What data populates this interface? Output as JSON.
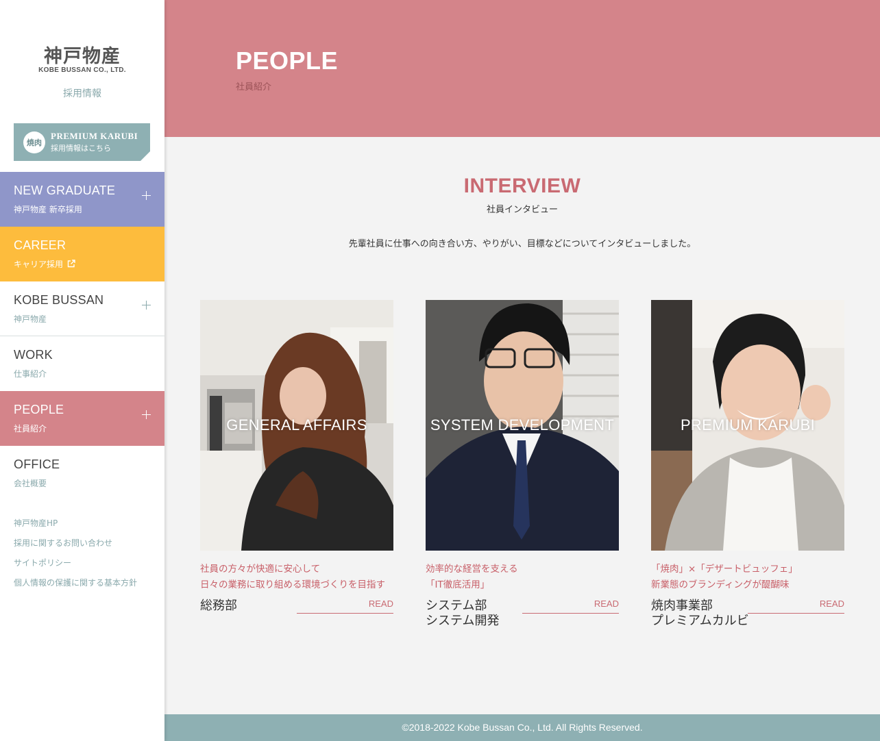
{
  "sidebar": {
    "logo_jp": "神戸物産",
    "logo_en": "KOBE BUSSAN CO., LTD.",
    "recruit_label": "採用情報",
    "banner": {
      "emblem": "焼肉",
      "title": "PREMIUM KARUBI",
      "subtitle": "採用情報はこちら"
    },
    "nav": [
      {
        "en": "NEW GRADUATE",
        "jp": "神戸物産 新卒採用",
        "color": "#8f96c9"
      },
      {
        "en": "CAREER",
        "jp": "キャリア採用",
        "color": "#fdbc3d",
        "icon": "external-link-icon"
      },
      {
        "en": "KOBE BUSSAN",
        "jp": "神戸物産"
      },
      {
        "en": "WORK",
        "jp": "仕事紹介"
      },
      {
        "en": "PEOPLE",
        "jp": "社員紹介",
        "color": "#d4848a",
        "active": true
      },
      {
        "en": "OFFICE",
        "jp": "会社概要"
      }
    ],
    "links": [
      "神戸物産HP",
      "採用に関するお問い合わせ",
      "サイトポリシー",
      "個人情報の保護に関する基本方針"
    ]
  },
  "hero": {
    "title": "PEOPLE",
    "subtitle": "社員紹介",
    "color": "#d4848a"
  },
  "section": {
    "title": "INTERVIEW",
    "subtitle": "社員インタビュー",
    "intro": "先輩社員に仕事への向き合い方、やりがい、目標などについてインタビューしました。"
  },
  "cards": [
    {
      "label": "GENERAL AFFAIRS",
      "catch_1": "社員の方々が快適に安心して",
      "catch_2": "日々の業務に取り組める環境づくりを目指す",
      "dept": "総務部",
      "read": "READ"
    },
    {
      "label": "SYSTEM DEVELOPMENT",
      "catch_1": "効率的な経営を支える",
      "catch_2": "「IT徹底活用」",
      "dept": "システム部\nシステム開発",
      "read": "READ"
    },
    {
      "label": "PREMIUM KARUBI",
      "catch_1": "「焼肉」×「デザートビュッフェ」",
      "catch_2": "新業態のブランディングが醍醐味",
      "dept": "焼肉事業部\nプレミアムカルビ",
      "read": "READ"
    }
  ],
  "footer": {
    "copyright": "©2018-2022 Kobe Bussan Co., Ltd. All Rights Reserved."
  }
}
